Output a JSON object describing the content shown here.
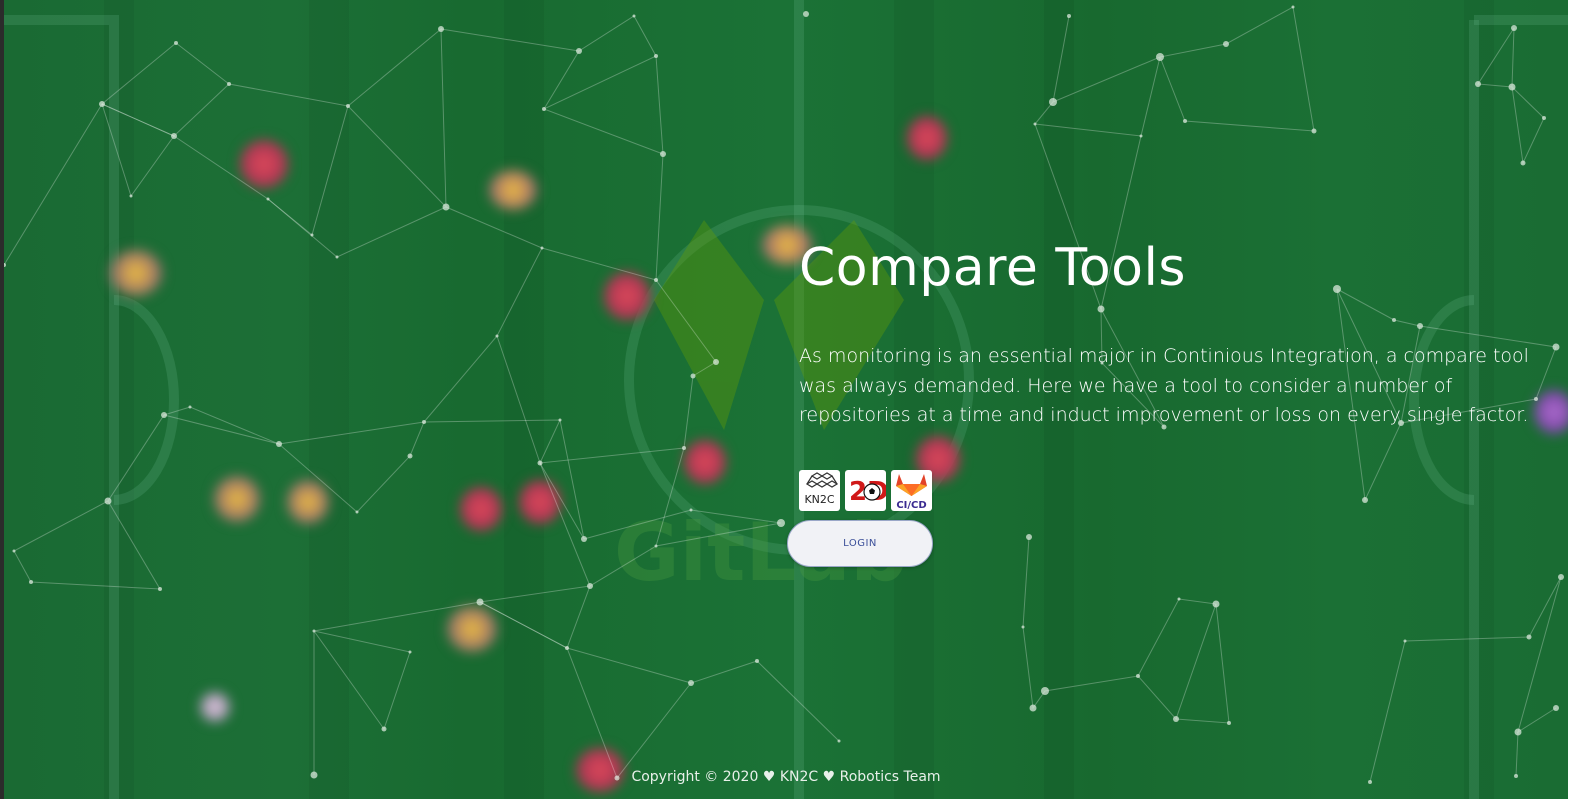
{
  "hero": {
    "title": "Compare Tools",
    "description": "As monitoring is an essential major in Continious Integration, a compare tool was always demanded. Here we have a tool to consider a number of repositories at a time and induct improvement or loss on every single factor."
  },
  "logos": [
    {
      "name": "kn2c-logo",
      "text": "KN2C"
    },
    {
      "name": "robocup-2d-logo",
      "text": "2D"
    },
    {
      "name": "gitlab-cicd-logo",
      "text": "CI/CD"
    }
  ],
  "login": {
    "label": "LOGIN"
  },
  "footer": {
    "text": "Copyright © 2020 ♥ KN2C ♥ Robotics Team"
  },
  "colors": {
    "background": "#1b6e34",
    "accent": "#3b4f99",
    "text": "#ffffff"
  }
}
